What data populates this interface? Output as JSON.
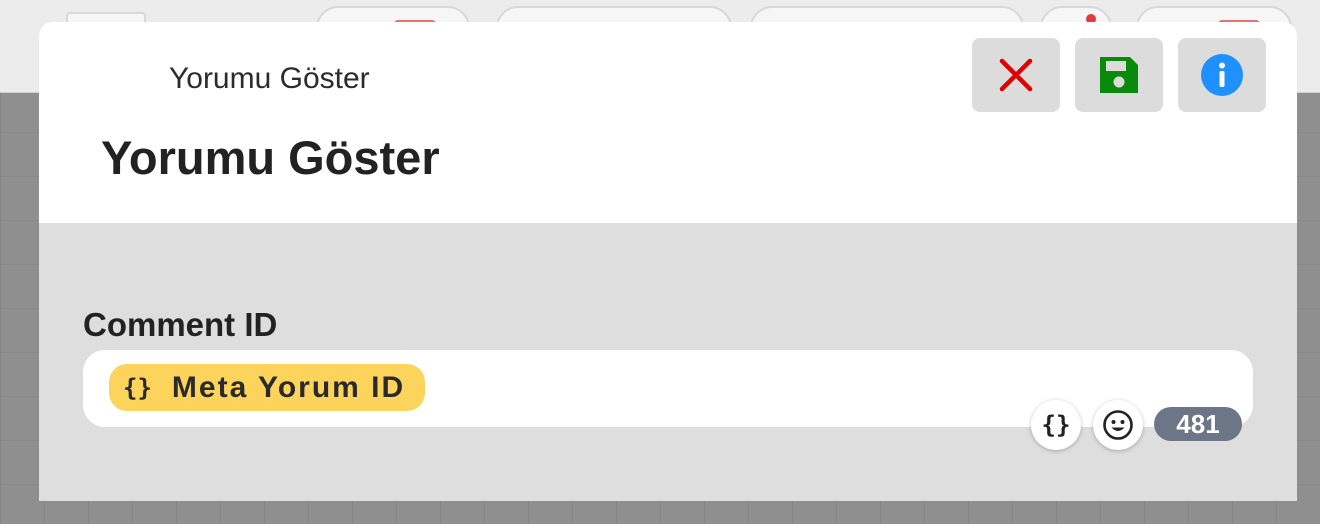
{
  "header": {
    "breadcrumb": "Yorumu Göster",
    "title": "Yorumu Göster"
  },
  "toolbar": {
    "close_icon": "close-icon",
    "save_icon": "floppy-disk-icon",
    "info_icon": "info-icon",
    "colors": {
      "close": "#e00000",
      "save": "#0a8a0a",
      "info": "#1e90ff"
    }
  },
  "field": {
    "label": "Comment ID",
    "chip_icon": "{}",
    "chip_label": "Meta Yorum ID",
    "chip_color": "#fcd45c"
  },
  "tools": {
    "variables_icon": "{}",
    "emoji_icon": "smiley-icon",
    "char_count": "481"
  }
}
